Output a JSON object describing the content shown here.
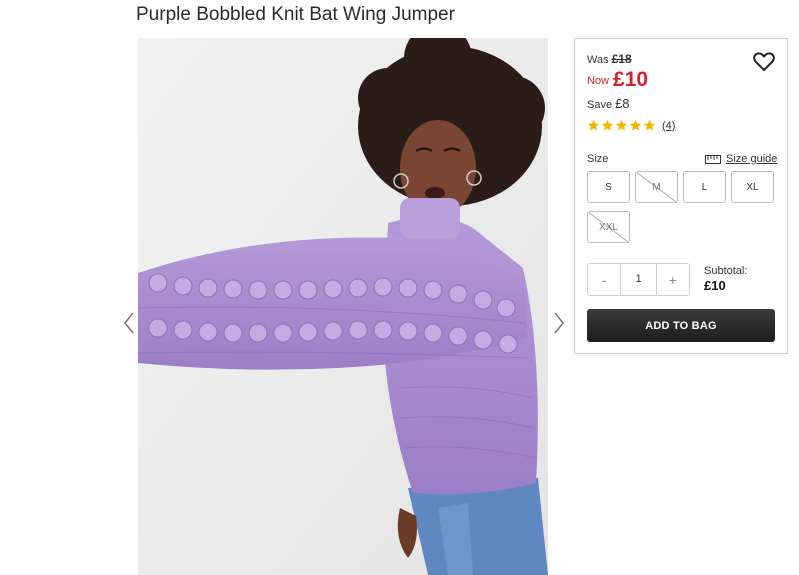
{
  "product": {
    "title": "Purple Bobbled Knit Bat Wing Jumper"
  },
  "gallery": {
    "image_alt": "Model wearing purple bobbled knit bat wing jumper",
    "prev_icon": "chevron-left-icon",
    "next_icon": "chevron-right-icon"
  },
  "pricing": {
    "was_label": "Was",
    "was_price": "£18",
    "now_label": "Now",
    "now_price": "£10",
    "save_label": "Save",
    "save_amount": "£8"
  },
  "rating": {
    "stars": 5,
    "max": 5,
    "count_text": "(4)",
    "star_color": "#f5b800"
  },
  "wishlist": {
    "icon": "heart-icon"
  },
  "sizes": {
    "label": "Size",
    "guide_label": "Size guide",
    "guide_icon": "ruler-icon",
    "options": [
      {
        "label": "S",
        "available": true
      },
      {
        "label": "M",
        "available": false
      },
      {
        "label": "L",
        "available": true
      },
      {
        "label": "XL",
        "available": true
      },
      {
        "label": "XXL",
        "available": false
      }
    ]
  },
  "quantity": {
    "minus": "-",
    "value": "1",
    "plus": "+"
  },
  "subtotal": {
    "label": "Subtotal:",
    "value": "£10"
  },
  "cta": {
    "add_to_bag": "ADD TO BAG"
  },
  "colors": {
    "sale_red": "#d2232a",
    "cta_dark": "#222222",
    "jumper_purple": "#a98bd0"
  }
}
